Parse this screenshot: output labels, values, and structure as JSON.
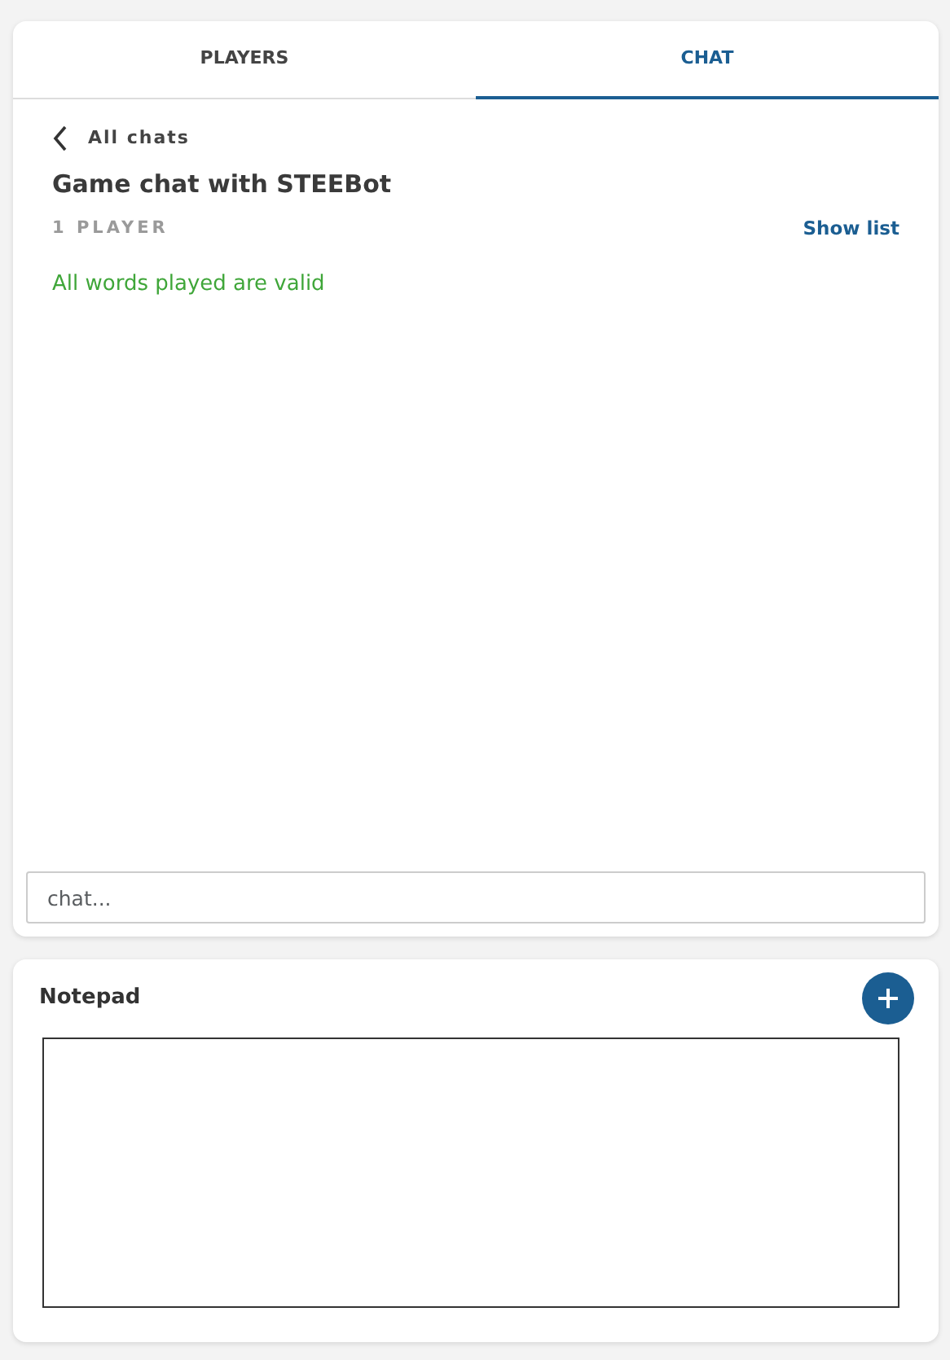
{
  "tabs": [
    {
      "label": "PLAYERS",
      "selected": false
    },
    {
      "label": "CHAT",
      "selected": true
    }
  ],
  "chat": {
    "back_label": "All chats",
    "title": "Game chat with STEEBot",
    "player_count": "1 PLAYER",
    "show_list": "Show list",
    "messages": [
      {
        "text": "All words played are valid",
        "kind": "system"
      }
    ],
    "input": {
      "placeholder": "chat..."
    }
  },
  "notepad": {
    "title": "Notepad"
  }
}
